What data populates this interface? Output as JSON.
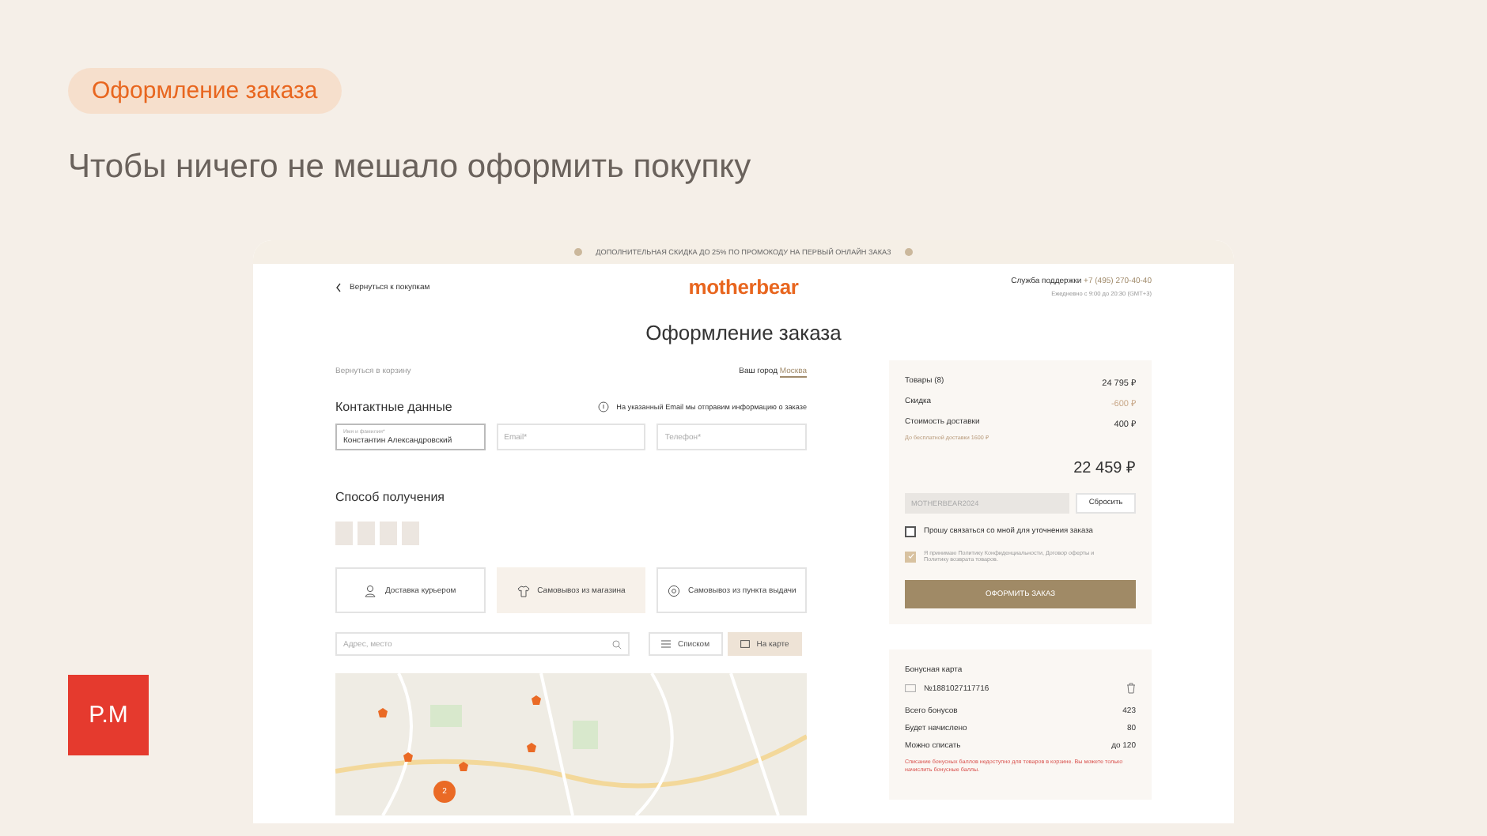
{
  "slide": {
    "tag": "Оформление заказа",
    "headline": "Чтобы ничего не мешало оформить покупку",
    "logo": "P.M"
  },
  "screen": {
    "promo_banner": "ДОПОЛНИТЕЛЬНАЯ СКИДКА ДО 25% ПО ПРОМОКОДУ НА ПЕРВЫЙ ОНЛАЙН ЗАКАЗ",
    "header": {
      "back_link": "Вернуться к покупкам",
      "logo": "motherbear",
      "support_label": "Служба поддержки",
      "support_phone": "+7 (495) 270-40-40",
      "support_hours": "Ежедневно с 9:00 до 20:30 (GMT+3)"
    },
    "title": "Оформление заказа",
    "cart_link": "Вернуться в корзину",
    "city_label": "Ваш город",
    "city": "Москва",
    "contacts": {
      "heading": "Контактные данные",
      "note": "На указанный Email мы отправим информацию о заказе",
      "fields": [
        {
          "label": "Имя и фамилия*",
          "value": "Константин Александровский"
        },
        {
          "placeholder": "Email*"
        },
        {
          "placeholder": "Телефон*"
        }
      ]
    },
    "delivery": {
      "heading": "Способ получения",
      "options": [
        {
          "kind": "courier",
          "label": "Доставка курьером",
          "selected": false
        },
        {
          "kind": "store",
          "label": "Самовывоз из магазина",
          "selected": true
        },
        {
          "kind": "pickup",
          "label": "Самовывоз из пункта выдачи",
          "selected": false
        }
      ],
      "search": {
        "placeholder": "Адрес, место"
      },
      "views": [
        {
          "kind": "list",
          "label": "Списком",
          "selected": false
        },
        {
          "kind": "map",
          "label": "На карте",
          "selected": true
        }
      ],
      "map": {
        "cluster_count": "2"
      }
    },
    "summary": {
      "rows": [
        {
          "label": "Товары (8)",
          "value": "24 795 ₽",
          "kind": "normal"
        },
        {
          "label": "Скидка",
          "value": "-600 ₽",
          "kind": "discount"
        },
        {
          "label": "Стоимость доставки",
          "value": "400 ₽",
          "kind": "normal"
        }
      ],
      "delivery_note": "До бесплатной доставки 1600 ₽",
      "total": "22 459 ₽",
      "promo_code": "MOTHERBEAR2024",
      "reset_button": "Сбросить",
      "checkboxes": [
        {
          "label": "Прошу связаться со мной для уточнения заказа",
          "checked": false
        },
        {
          "label": "Я принимаю Политику Конфиденциальности, Договор оферты и Политику возврата товаров.",
          "checked": true
        }
      ],
      "submit_button": "ОФОРМИТЬ ЗАКАЗ"
    },
    "bonus": {
      "heading": "Бонусная карта",
      "card_number": "№1881027117716",
      "rows": [
        {
          "label": "Всего бонусов",
          "value": "423"
        },
        {
          "label": "Будет начислено",
          "value": "80"
        },
        {
          "label": "Можно списать",
          "value": "до 120"
        }
      ],
      "warning": "Списание бонусных баллов недоступно для товаров в корзине. Вы можете только начислить бонусные баллы."
    }
  }
}
